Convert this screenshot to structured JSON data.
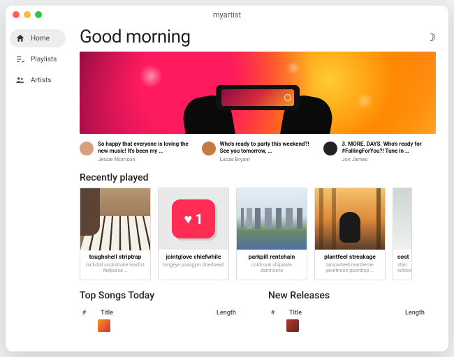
{
  "window": {
    "title": "myartist"
  },
  "sidebar": {
    "items": [
      {
        "label": "Home"
      },
      {
        "label": "Playlists"
      },
      {
        "label": "Artists"
      }
    ]
  },
  "header": {
    "greeting": "Good morning"
  },
  "posts": [
    {
      "text": "So happy that everyone is loving the new music! It's been my …",
      "author": "Jessie Morrison"
    },
    {
      "text": "Who's ready to party this weekend?! See you tomorrow, …",
      "author": "Lucas Bryant"
    },
    {
      "text": "3. MORE. DAYS. Who's ready for #FallingForYou?! Tune in …",
      "author": "Jon James"
    }
  ],
  "sections": {
    "recently_played": "Recently played",
    "top_songs": "Top Songs Today",
    "new_releases": "New Releases"
  },
  "cards": [
    {
      "title": "toughshell striptrap",
      "sub": "rackdoll sockstroke rearfist feelpiece …"
    },
    {
      "title": "jointglove chiefwhile",
      "sub": "longeye passgym driedneed"
    },
    {
      "title": "parkpill rentchain",
      "sub": "coldcook shipaisle damncave"
    },
    {
      "title": "plantfeel streakage",
      "sub": "lampwheel reartheme pointnoon poordrop …"
    },
    {
      "title": "cost",
      "sub": "stari school"
    }
  ],
  "like_card": {
    "count": "1"
  },
  "table": {
    "cols": {
      "num": "#",
      "title": "Title",
      "length": "Length"
    }
  }
}
